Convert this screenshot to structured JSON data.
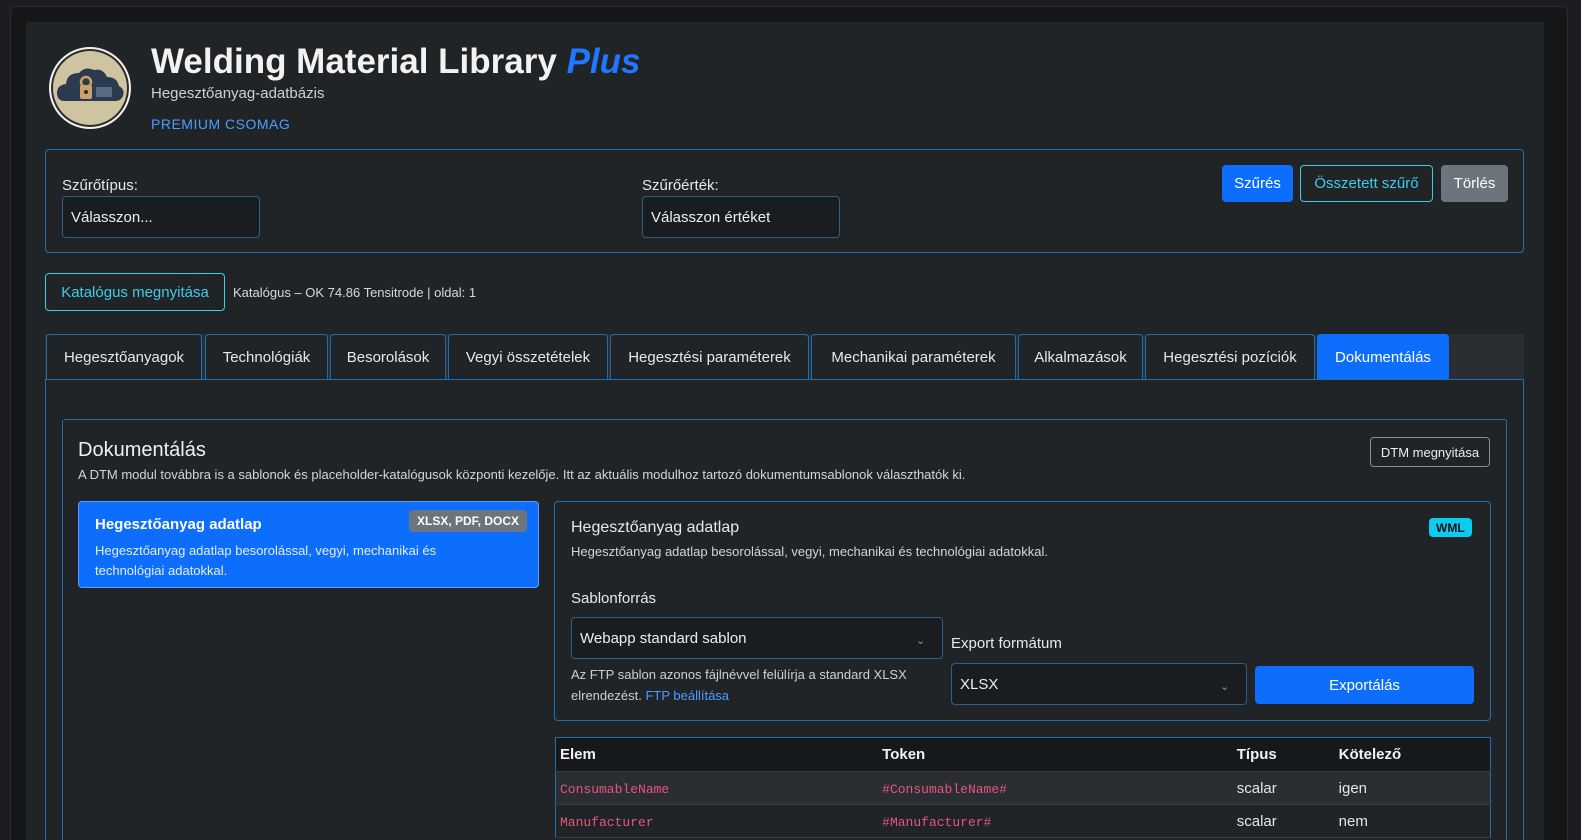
{
  "header": {
    "title": "Welding Material Library",
    "title_accent": "Plus",
    "subtitle": "Hegesztőanyag-adatbázis",
    "package": "PREMIUM CSOMAG",
    "logo_icon": "cloud-lock-icon"
  },
  "filter": {
    "type_label": "Szűrőtípus:",
    "type_value": "Válasszon...",
    "value_label": "Szűrőérték:",
    "value_value": "Válasszon értéket",
    "filter_button": "Szűrés",
    "compound_button": "Összetett szűrő",
    "clear_button": "Törlés"
  },
  "catalog": {
    "open_button": "Katalógus megnyitása",
    "status": "Katalógus – OK 74.86 Tensitrode | oldal: 1"
  },
  "tabs": [
    {
      "label": "Hegesztőanyagok"
    },
    {
      "label": "Technológiák"
    },
    {
      "label": "Besorolások"
    },
    {
      "label": "Vegyi összetételek"
    },
    {
      "label": "Hegesztési paraméterek"
    },
    {
      "label": "Mechanikai paraméterek"
    },
    {
      "label": "Alkalmazások"
    },
    {
      "label": "Hegesztési pozíciók"
    },
    {
      "label": "Dokumentálás",
      "active": true
    }
  ],
  "docs": {
    "title": "Dokumentálás",
    "description": "A DTM modul továbbra is a sablonok és placeholder-katalógusok központi kezelője. Itt az aktuális modulhoz tartozó dokumentumsablonok választhatók ki.",
    "dtm_button": "DTM megnyitása",
    "template": {
      "title": "Hegesztőanyag adatlap",
      "formats": "XLSX, PDF, DOCX",
      "description": "Hegesztőanyag adatlap besorolással, vegyi, mechanikai és technológiai adatokkal."
    },
    "detail": {
      "title": "Hegesztőanyag adatlap",
      "badge": "WML",
      "description": "Hegesztőanyag adatlap besorolással, vegyi, mechanikai és technológiai adatokkal.",
      "source_label": "Sablonforrás",
      "source_value": "Webapp standard sablon",
      "ftp_hint": "Az FTP sablon azonos fájlnévvel felülírja a standard XLSX elrendezést.",
      "ftp_link": "FTP beállítása",
      "export_label": "Export formátum",
      "export_value": "XLSX",
      "export_button": "Exportálás"
    },
    "table": {
      "headers": [
        "Elem",
        "Token",
        "Típus",
        "Kötelező"
      ],
      "rows": [
        [
          "ConsumableName",
          "#ConsumableName#",
          "scalar",
          "igen"
        ],
        [
          "Manufacturer",
          "#Manufacturer#",
          "scalar",
          "nem"
        ]
      ]
    }
  },
  "colors": {
    "accent": "#0d6efd",
    "border": "#1e6fb0",
    "cyan": "#0dcaf0",
    "code": "#e8547e"
  }
}
